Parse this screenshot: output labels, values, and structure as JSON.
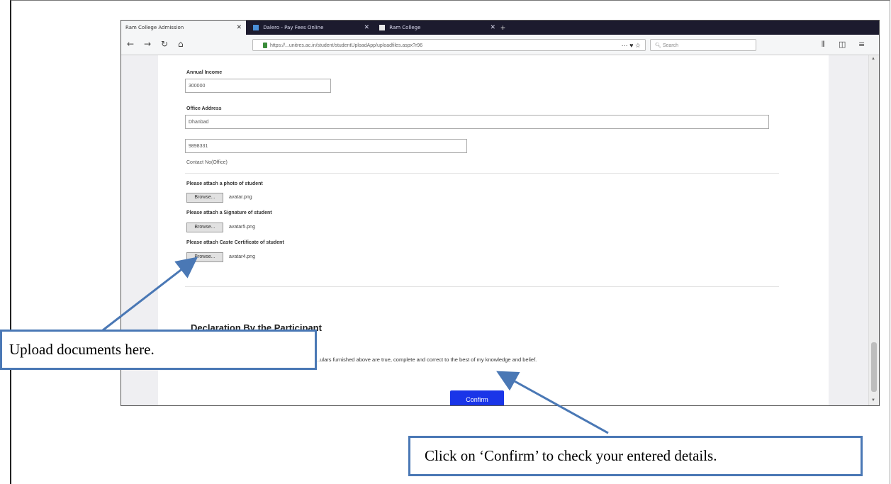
{
  "browser": {
    "tabs": [
      {
        "label": "Ram College Admission",
        "close": "✕"
      },
      {
        "label": "Dalero - Pay Fees Online",
        "close": "✕"
      },
      {
        "label": "Ram College",
        "close": "✕"
      }
    ],
    "new_tab": "+",
    "nav": {
      "back": "←",
      "forward": "→",
      "reload": "↻",
      "home": "⌂"
    },
    "url": "https://...unitres.ac.in/student/studentUploadApp/uploadfiles.aspx?r96",
    "url_actions": "··· ♥ ☆",
    "search_placeholder": "Search",
    "toolbar_icons": {
      "library": "⫴",
      "sidebar": "◫",
      "menu": "≡"
    }
  },
  "form": {
    "annual_income_label": "Annual Income",
    "annual_income_value": "300000",
    "office_address_label": "Office Address",
    "office_address_value": "Dhanbad",
    "contact_value": "9898331",
    "contact_caption": "Contact No(Office)",
    "uploads": [
      {
        "label": "Please attach a photo of student",
        "button": "Browse...",
        "file": "avatar.png"
      },
      {
        "label": "Please attach a Signature of student",
        "button": "Browse...",
        "file": "avatar5.png"
      },
      {
        "label": "Please attach Caste Certificate of student",
        "button": "Browse...",
        "file": "avatar4.png"
      }
    ],
    "declaration_title": "Declaration By the Participant",
    "declaration_text": "...ulars furnished above are true, complete and correct to the best of my knowledge and belief.",
    "confirm_label": "Confirm"
  },
  "callouts": {
    "upload": "Upload documents here.",
    "confirm": "Click on ‘Confirm’ to check your entered details."
  },
  "colors": {
    "confirm_button": "#1a35e8",
    "callout_border": "#4a78b5",
    "tab_bar": "#1c1b2e"
  }
}
